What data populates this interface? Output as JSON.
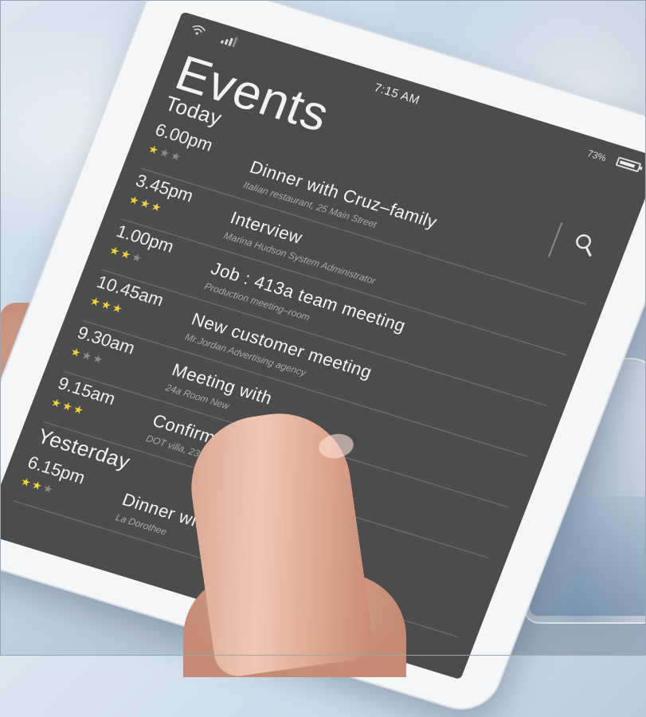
{
  "status_bar": {
    "time": "7:15 AM",
    "battery": "73%"
  },
  "header": {
    "title": "Events"
  },
  "sections": [
    {
      "label": "Today",
      "events": [
        {
          "time": "6.00pm",
          "stars": 1,
          "title": "Dinner with Cruz–family",
          "subtitle": "Italian restaurant, 25 Main Street"
        },
        {
          "time": "3.45pm",
          "stars": 3,
          "title": "Interview",
          "subtitle": "Marina Hudson  System Administrator"
        },
        {
          "time": "1.00pm",
          "stars": 2,
          "title": "Job : 413a team meeting",
          "subtitle": "Production meeting–room"
        },
        {
          "time": "10.45am",
          "stars": 3,
          "title": "New customer meeting",
          "subtitle": "Mr.Jordan   Advertising agency"
        },
        {
          "time": "9.30am",
          "stars": 1,
          "title": "Meeting with",
          "subtitle": "24a Room   New"
        },
        {
          "time": "9.15am",
          "stars": 3,
          "title": "Confirm location",
          "subtitle": "DOT villa, 23PD  Main   planning"
        }
      ]
    },
    {
      "label": "Yesterday",
      "events": [
        {
          "time": "6.15pm",
          "stars": 2,
          "title": "Dinner with",
          "subtitle": "La Dorothee"
        }
      ]
    }
  ],
  "colors": {
    "screen_bg": "#4c4c4c",
    "star_active": "#f2d23a",
    "star_inactive": "#8c8c8c"
  }
}
